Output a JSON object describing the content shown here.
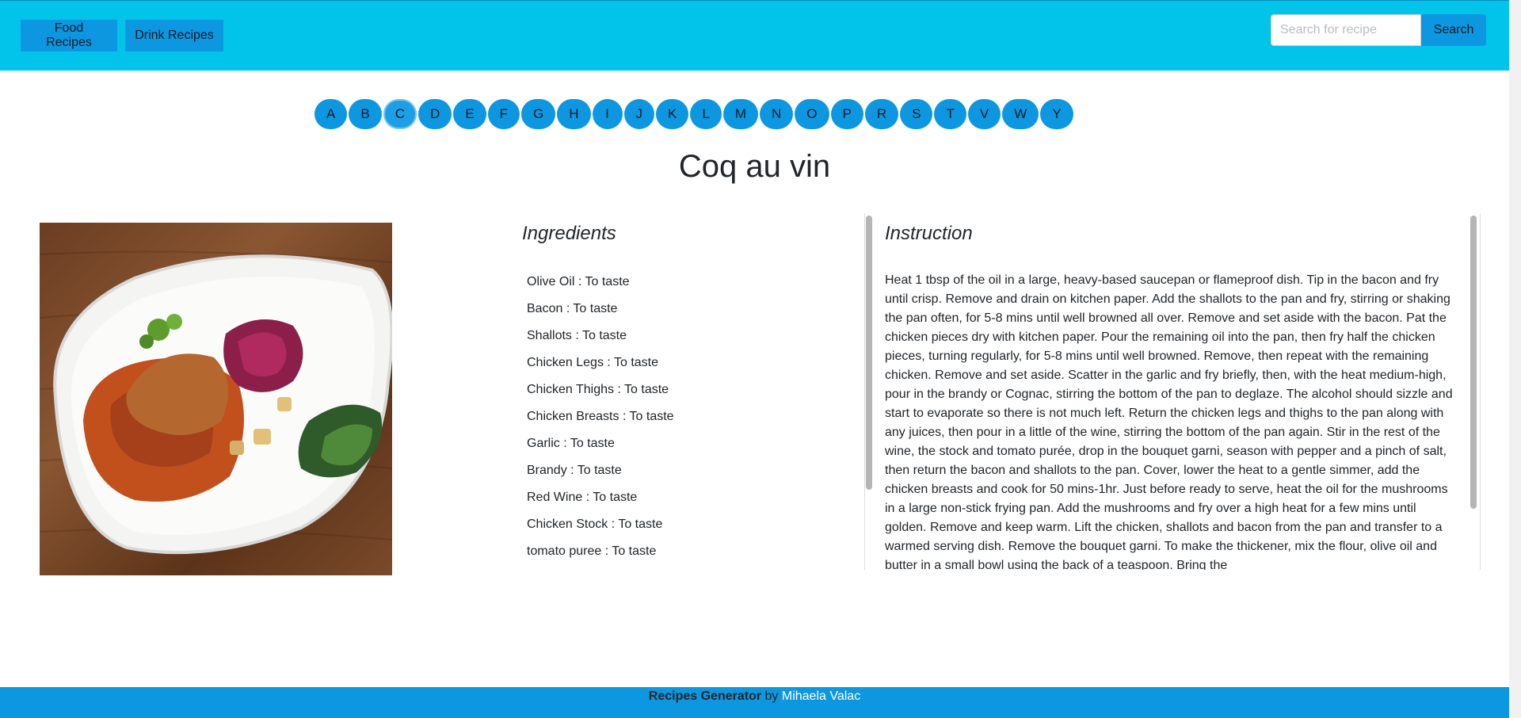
{
  "nav": {
    "food_label": "Food Recipes",
    "drink_label": "Drink Recipes",
    "search_placeholder": "Search for recipe",
    "search_value": "",
    "search_button": "Search"
  },
  "letters": [
    "A",
    "B",
    "C",
    "D",
    "E",
    "F",
    "G",
    "H",
    "I",
    "J",
    "K",
    "L",
    "M",
    "N",
    "O",
    "P",
    "R",
    "S",
    "T",
    "V",
    "W",
    "Y"
  ],
  "active_letter": "C",
  "recipe": {
    "title": "Coq au vin",
    "ingredients_heading": "Ingredients",
    "ingredients": [
      "Olive Oil : To taste",
      "Bacon : To taste",
      "Shallots : To taste",
      "Chicken Legs : To taste",
      "Chicken Thighs : To taste",
      "Chicken Breasts : To taste",
      "Garlic : To taste",
      "Brandy : To taste",
      "Red Wine : To taste",
      "Chicken Stock : To taste",
      "tomato puree : To taste"
    ],
    "instruction_heading": "Instruction",
    "instruction_text": "Heat 1 tbsp of the oil in a large, heavy-based saucepan or flameproof dish. Tip in the bacon and fry until crisp. Remove and drain on kitchen paper. Add the shallots to the pan and fry, stirring or shaking the pan often, for 5-8 mins until well browned all over. Remove and set aside with the bacon. Pat the chicken pieces dry with kitchen paper. Pour the remaining oil into the pan, then fry half the chicken pieces, turning regularly, for 5-8 mins until well browned. Remove, then repeat with the remaining chicken. Remove and set aside. Scatter in the garlic and fry briefly, then, with the heat medium-high, pour in the brandy or Cognac, stirring the bottom of the pan to deglaze. The alcohol should sizzle and start to evaporate so there is not much left. Return the chicken legs and thighs to the pan along with any juices, then pour in a little of the wine, stirring the bottom of the pan again. Stir in the rest of the wine, the stock and tomato purée, drop in the bouquet garni, season with pepper and a pinch of salt, then return the bacon and shallots to the pan. Cover, lower the heat to a gentle simmer, add the chicken breasts and cook for 50 mins-1hr. Just before ready to serve, heat the oil for the mushrooms in a large non-stick frying pan. Add the mushrooms and fry over a high heat for a few mins until golden. Remove and keep warm. Lift the chicken, shallots and bacon from the pan and transfer to a warmed serving dish. Remove the bouquet garni. To make the thickener, mix the flour, olive oil and butter in a small bowl using the back of a teaspoon. Bring the"
  },
  "footer": {
    "brand": "Recipes Generator",
    "by": " by ",
    "author": "Mihaela Valac"
  },
  "colors": {
    "header_bg": "#02c3ea",
    "button_bg": "#0d97e0",
    "footer_bg": "#0d97e0"
  }
}
